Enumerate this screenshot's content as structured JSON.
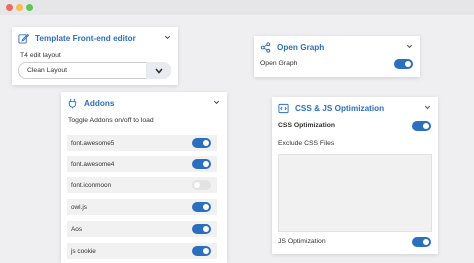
{
  "panels": {
    "template": {
      "title": "Template Front-end editor",
      "field_label": "T4 edit layout",
      "select_value": "Clean Layout"
    },
    "open_graph": {
      "title": "Open Graph",
      "toggle_label": "Open Graph",
      "toggle_on": true
    },
    "addons": {
      "title": "Addons",
      "description": "Toggle Addons on/off to load",
      "items": [
        {
          "label": "font.awesome5",
          "on": true
        },
        {
          "label": "font.awesome4",
          "on": true
        },
        {
          "label": "font.iconmoon",
          "on": false
        },
        {
          "label": "owl.js",
          "on": true
        },
        {
          "label": "Aos",
          "on": true
        },
        {
          "label": "js cookie",
          "on": true
        }
      ]
    },
    "css_js": {
      "title": "CSS & JS Optimization",
      "css_label": "CSS Optimization",
      "exclude_label": "Exclude CSS Files",
      "js_label": "JS Optimization"
    }
  },
  "colors": {
    "accent": "#2d6fbf",
    "toggle_off": "#e3e3e3",
    "row_bg": "#f1f1f1"
  },
  "icons": [
    "edit-icon",
    "share-icon",
    "plug-icon",
    "code-icon",
    "chevron-down-icon"
  ]
}
